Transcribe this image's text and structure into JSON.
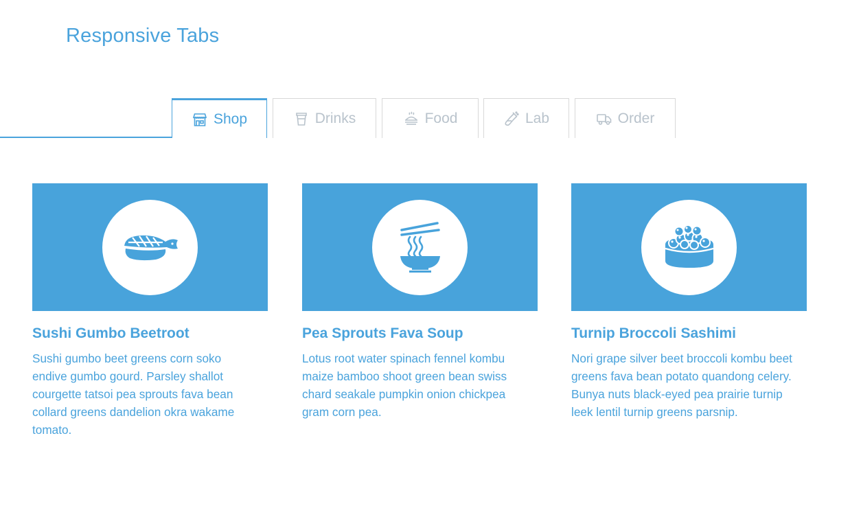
{
  "page": {
    "title": "Responsive Tabs"
  },
  "tabs": [
    {
      "label": "Shop",
      "icon": "shop-icon",
      "active": true
    },
    {
      "label": "Drinks",
      "icon": "cup-icon",
      "active": false
    },
    {
      "label": "Food",
      "icon": "dish-icon",
      "active": false
    },
    {
      "label": "Lab",
      "icon": "flask-icon",
      "active": false
    },
    {
      "label": "Order",
      "icon": "truck-icon",
      "active": false
    }
  ],
  "cards": [
    {
      "icon": "shrimp-sushi-icon",
      "title": "Sushi Gumbo Beetroot",
      "text": "Sushi gumbo beet greens corn soko endive gumbo gourd. Parsley shallot courgette tatsoi pea sprouts fava bean collard greens dandelion okra wakame tomato."
    },
    {
      "icon": "noodle-bowl-icon",
      "title": "Pea Sprouts Fava Soup",
      "text": "Lotus root water spinach fennel kombu maize bamboo shoot green bean swiss chard seakale pumpkin onion chickpea gram corn pea."
    },
    {
      "icon": "roe-sushi-icon",
      "title": "Turnip Broccoli Sashimi",
      "text": "Nori grape silver beet broccoli kombu beet greens fava bean potato quandong celery. Bunya nuts black-eyed pea prairie turnip leek lentil turnip greens parsnip."
    }
  ],
  "colors": {
    "accent": "#4aa3dc",
    "hero": "#48a3db",
    "inactive": "#b9c3cc",
    "border": "#d8d8d8"
  }
}
